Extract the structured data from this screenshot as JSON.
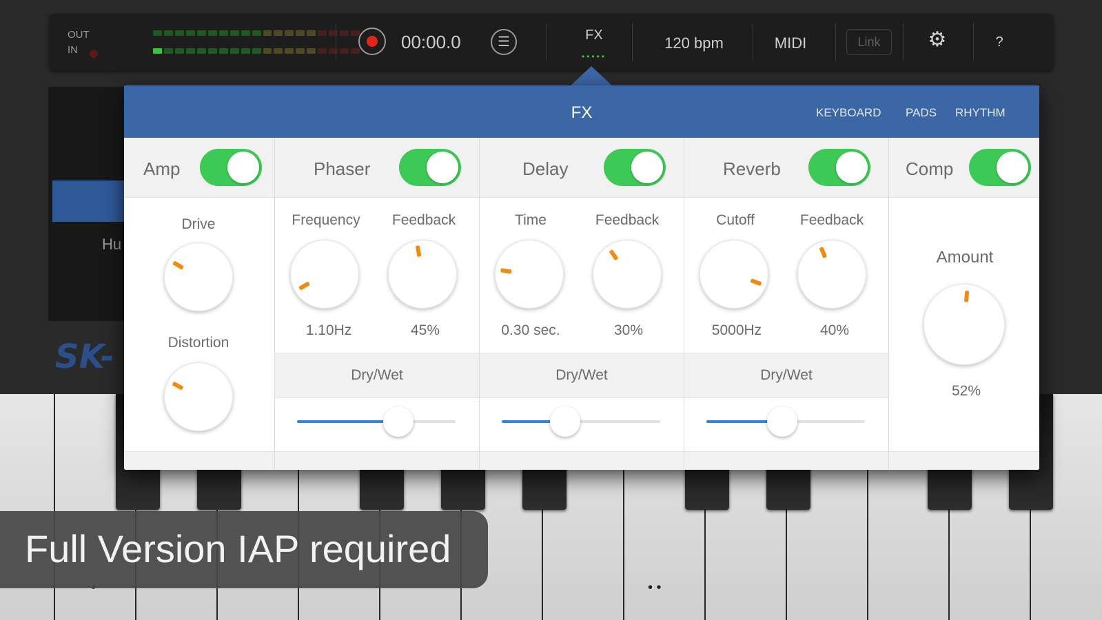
{
  "topbar": {
    "out_label": "OUT",
    "in_label": "IN",
    "time": "00:00.0",
    "list_icon": "list-icon",
    "fx_label": "FX",
    "fx_dots": "•••••",
    "tempo": "120 bpm",
    "midi": "MIDI",
    "link": "Link",
    "settings_icon": "gear-icon",
    "help": "?"
  },
  "background": {
    "partial_text": "Hu",
    "logo_partial": "SK-"
  },
  "fx_panel": {
    "title": "FX",
    "nav": [
      "KEYBOARD",
      "PADS",
      "RHYTHM"
    ],
    "effects": {
      "amp": {
        "name": "Amp",
        "enabled": true,
        "params": [
          {
            "label": "Drive"
          },
          {
            "label": "Distortion"
          }
        ]
      },
      "phaser": {
        "name": "Phaser",
        "enabled": true,
        "params": [
          {
            "label": "Frequency",
            "value": "1.10Hz"
          },
          {
            "label": "Feedback",
            "value": "45%"
          }
        ],
        "drywet_label": "Dry/Wet",
        "drywet": 0.64
      },
      "delay": {
        "name": "Delay",
        "enabled": true,
        "params": [
          {
            "label": "Time",
            "value": "0.30 sec."
          },
          {
            "label": "Feedback",
            "value": "30%"
          }
        ],
        "drywet_label": "Dry/Wet",
        "drywet": 0.4
      },
      "reverb": {
        "name": "Reverb",
        "enabled": true,
        "params": [
          {
            "label": "Cutoff",
            "value": "5000Hz"
          },
          {
            "label": "Feedback",
            "value": "40%"
          }
        ],
        "drywet_label": "Dry/Wet",
        "drywet": 0.48
      },
      "comp": {
        "name": "Comp",
        "enabled": true,
        "params": [
          {
            "label": "Amount",
            "value": "52%"
          }
        ]
      }
    }
  },
  "banner": {
    "text": "Full Version IAP required"
  },
  "colors": {
    "header": "#3c67a6",
    "toggle_on": "#3dc955",
    "knob_tick": "#f08a12",
    "slider_fill": "#2f86e2"
  }
}
